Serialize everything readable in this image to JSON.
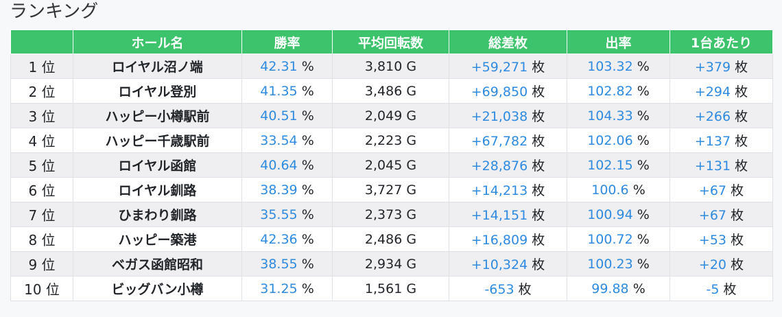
{
  "page": {
    "title": "ランキング"
  },
  "table": {
    "headers": [
      "",
      "ホール名",
      "勝率",
      "平均回転数",
      "総差枚",
      "出率",
      "1台あたり"
    ],
    "rows": [
      {
        "rank": "1 位",
        "hall": "ロイヤル沼ノ端",
        "win_rate": "42.31",
        "win_rate_unit": "%",
        "avg_spins": "3,810 G",
        "total_diff": "+59,271",
        "total_diff_unit": "枚",
        "payout": "103.32",
        "payout_unit": "%",
        "per_machine": "+379",
        "per_machine_unit": "枚"
      },
      {
        "rank": "2 位",
        "hall": "ロイヤル登別",
        "win_rate": "41.35",
        "win_rate_unit": "%",
        "avg_spins": "3,486 G",
        "total_diff": "+69,850",
        "total_diff_unit": "枚",
        "payout": "102.82",
        "payout_unit": "%",
        "per_machine": "+294",
        "per_machine_unit": "枚"
      },
      {
        "rank": "3 位",
        "hall": "ハッピー小樽駅前",
        "win_rate": "40.51",
        "win_rate_unit": "%",
        "avg_spins": "2,049 G",
        "total_diff": "+21,038",
        "total_diff_unit": "枚",
        "payout": "104.33",
        "payout_unit": "%",
        "per_machine": "+266",
        "per_machine_unit": "枚"
      },
      {
        "rank": "4 位",
        "hall": "ハッピー千歳駅前",
        "win_rate": "33.54",
        "win_rate_unit": "%",
        "avg_spins": "2,223 G",
        "total_diff": "+67,782",
        "total_diff_unit": "枚",
        "payout": "102.06",
        "payout_unit": "%",
        "per_machine": "+137",
        "per_machine_unit": "枚"
      },
      {
        "rank": "5 位",
        "hall": "ロイヤル函館",
        "win_rate": "40.64",
        "win_rate_unit": "%",
        "avg_spins": "2,045 G",
        "total_diff": "+28,876",
        "total_diff_unit": "枚",
        "payout": "102.15",
        "payout_unit": "%",
        "per_machine": "+131",
        "per_machine_unit": "枚"
      },
      {
        "rank": "6 位",
        "hall": "ロイヤル釧路",
        "win_rate": "38.39",
        "win_rate_unit": "%",
        "avg_spins": "3,727 G",
        "total_diff": "+14,213",
        "total_diff_unit": "枚",
        "payout": "100.6",
        "payout_unit": "%",
        "per_machine": "+67",
        "per_machine_unit": "枚"
      },
      {
        "rank": "7 位",
        "hall": "ひまわり釧路",
        "win_rate": "35.55",
        "win_rate_unit": "%",
        "avg_spins": "2,373 G",
        "total_diff": "+14,151",
        "total_diff_unit": "枚",
        "payout": "100.94",
        "payout_unit": "%",
        "per_machine": "+67",
        "per_machine_unit": "枚"
      },
      {
        "rank": "8 位",
        "hall": "ハッピー築港",
        "win_rate": "42.36",
        "win_rate_unit": "%",
        "avg_spins": "2,486 G",
        "total_diff": "+16,809",
        "total_diff_unit": "枚",
        "payout": "100.72",
        "payout_unit": "%",
        "per_machine": "+53",
        "per_machine_unit": "枚"
      },
      {
        "rank": "9 位",
        "hall": "ベガス函館昭和",
        "win_rate": "38.55",
        "win_rate_unit": "%",
        "avg_spins": "2,934 G",
        "total_diff": "+10,324",
        "total_diff_unit": "枚",
        "payout": "100.23",
        "payout_unit": "%",
        "per_machine": "+20",
        "per_machine_unit": "枚"
      },
      {
        "rank": "10 位",
        "hall": "ビッグバン小樽",
        "win_rate": "31.25",
        "win_rate_unit": "%",
        "avg_spins": "1,561 G",
        "total_diff": "-653",
        "total_diff_unit": "枚",
        "payout": "99.88",
        "payout_unit": "%",
        "per_machine": "-5",
        "per_machine_unit": "枚"
      }
    ]
  },
  "colors": {
    "header_bg": "#3cc36b",
    "header_text": "#ffffff",
    "value_accent": "#2d8ae0",
    "row_odd": "#efeff1",
    "row_even": "#ffffff"
  }
}
